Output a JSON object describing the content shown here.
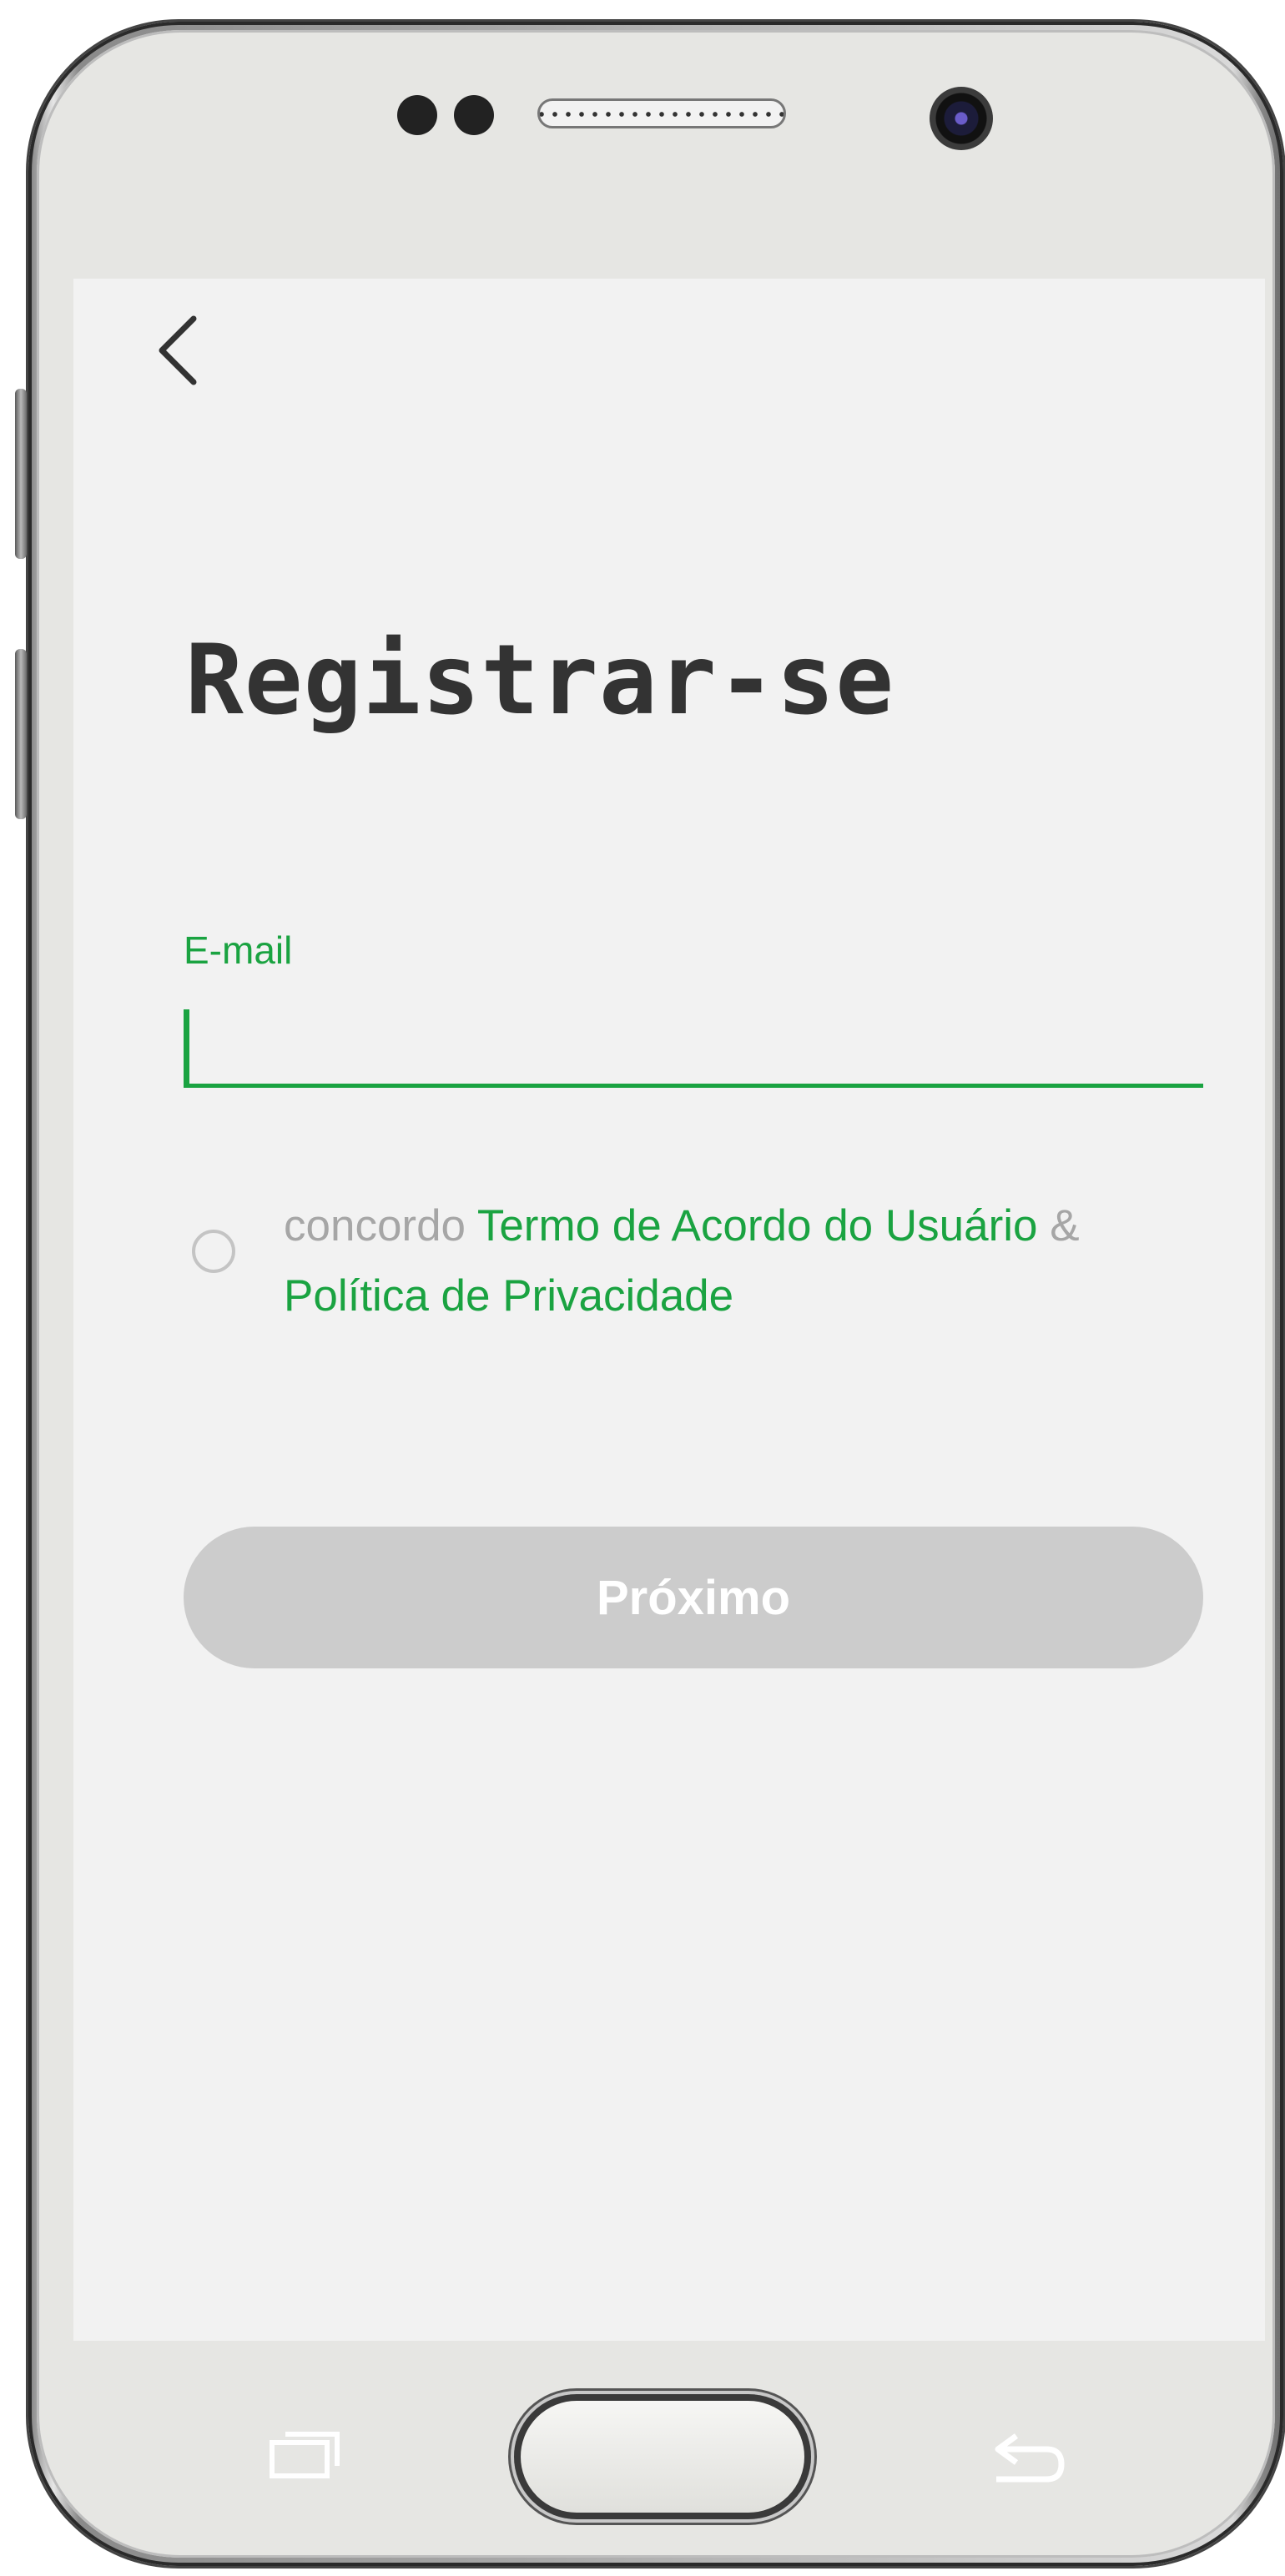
{
  "app": {
    "title": "Registrar-se",
    "accent_color": "#1aa341",
    "background_color": "#f2f2f2"
  },
  "header": {
    "back_icon": "chevron-left-icon"
  },
  "form": {
    "email": {
      "label": "E-mail",
      "value": "",
      "placeholder": ""
    },
    "agreement": {
      "checked": false,
      "prefix": "concordo",
      "terms_link": "Termo de Acordo do Usuário",
      "separator": "&",
      "privacy_link": "Política de Privacidade"
    },
    "next_button": {
      "label": "Próximo",
      "enabled": false,
      "color": "#cccccc"
    }
  },
  "device": {
    "nav_recent_icon": "recent-apps-icon",
    "nav_home_icon": "home-button-icon",
    "nav_back_icon": "back-arrow-icon"
  }
}
